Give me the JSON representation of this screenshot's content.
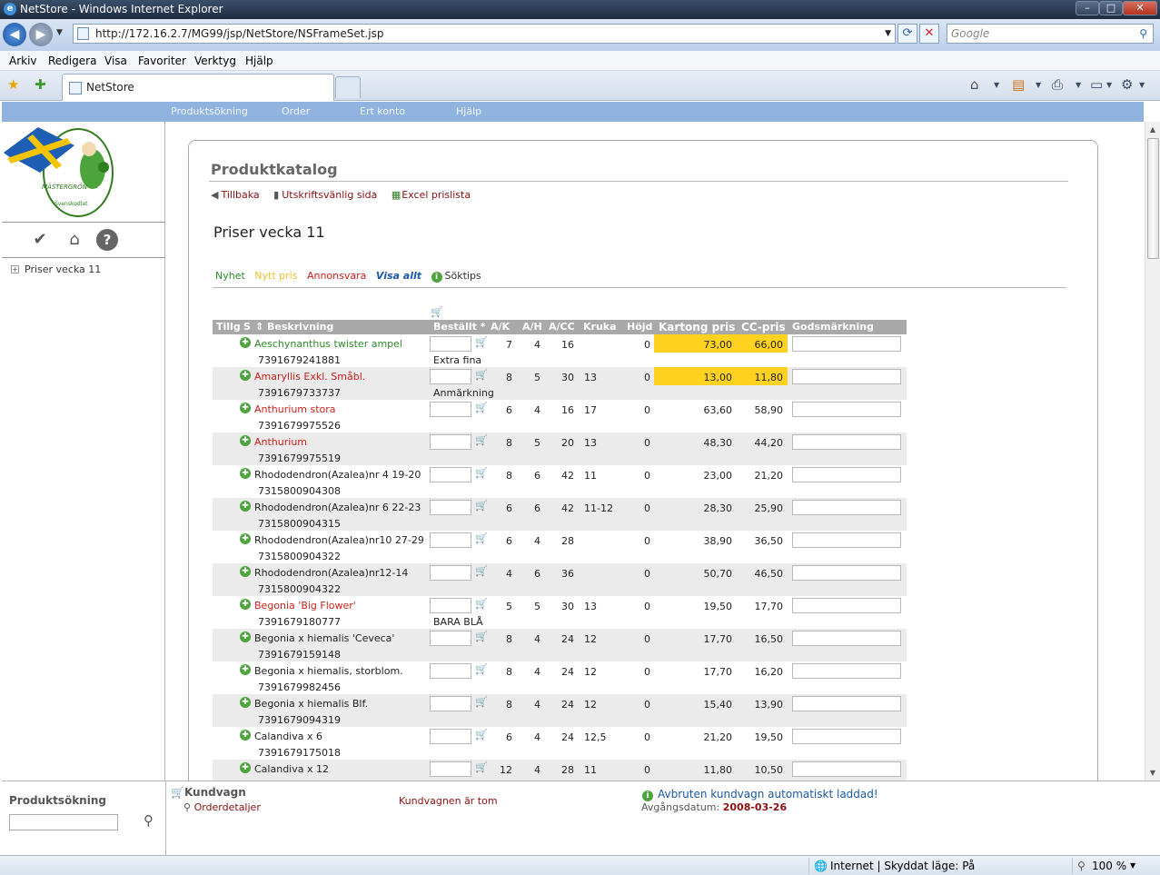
{
  "window": {
    "title": "NetStore - Windows Internet Explorer",
    "url": "http://172.16.2.7/MG99/jsp/NetStore/NSFrameSet.jsp",
    "search_placeholder": "Google",
    "tab_title": "NetStore"
  },
  "menu": [
    "Arkiv",
    "Redigera",
    "Visa",
    "Favoriter",
    "Verktyg",
    "Hjälp"
  ],
  "appnav": [
    "Produktsökning",
    "Order",
    "Ert konto",
    "Hjälp"
  ],
  "sidebar": {
    "tree_item": "Priser vecka 11",
    "logo_text": "MÄSTERGRÖN",
    "logo_sub": "Svenskodlat"
  },
  "page": {
    "title": "Produktkatalog",
    "back": "Tillbaka",
    "print": "Utskriftsvänlig sida",
    "excel": "Excel prislista",
    "heading": "Priser vecka 11"
  },
  "legend": [
    {
      "label": "Nyhet",
      "color": "#2f8a2a"
    },
    {
      "label": "Nytt pris",
      "color": "#f0c030"
    },
    {
      "label": "Annonsvara",
      "color": "#d0201a"
    },
    {
      "label": "Visa allt",
      "color": "#1a58a6"
    },
    {
      "label": "Söktips",
      "color": "#333333"
    }
  ],
  "table": {
    "headers": {
      "tillg": "Tillg",
      "s": "S",
      "beskrivning": "Beskrivning",
      "bestallt": "Beställt *",
      "ak": "A/K",
      "ah": "A/H",
      "acc": "A/CC",
      "kruka": "Kruka",
      "hojd": "Höjd",
      "kartong": "Kartong pris",
      "cc": "CC-pris",
      "gods": "Godsmärkning"
    },
    "rows": [
      {
        "name": "Aeschynanthus twister ampel",
        "ean": "7391679241881",
        "note": "Extra fina",
        "ak": "7",
        "ah": "4",
        "acc": "16",
        "kruka": "",
        "hojd": "0",
        "kartong": "73,00",
        "cc": "66,00",
        "color": "#2f8a2a",
        "highlight": true
      },
      {
        "name": "Amaryllis Exkl. Småbl.",
        "ean": "7391679733737",
        "note": "Anmärkning",
        "ak": "8",
        "ah": "5",
        "acc": "30",
        "kruka": "13",
        "hojd": "0",
        "kartong": "13,00",
        "cc": "11,80",
        "color": "#d0201a",
        "highlight": true
      },
      {
        "name": "Anthurium stora",
        "ean": "7391679975526",
        "note": "",
        "ak": "6",
        "ah": "4",
        "acc": "16",
        "kruka": "17",
        "hojd": "0",
        "kartong": "63,60",
        "cc": "58,90",
        "color": "#d0201a",
        "highlight": false
      },
      {
        "name": "Anthurium",
        "ean": "7391679975519",
        "note": "",
        "ak": "8",
        "ah": "5",
        "acc": "20",
        "kruka": "13",
        "hojd": "0",
        "kartong": "48,30",
        "cc": "44,20",
        "color": "#d0201a",
        "highlight": false
      },
      {
        "name": "Rhododendron(Azalea)nr 4 19-20",
        "ean": "7315800904308",
        "note": "",
        "ak": "8",
        "ah": "6",
        "acc": "42",
        "kruka": "11",
        "hojd": "0",
        "kartong": "23,00",
        "cc": "21,20",
        "color": "#222222",
        "highlight": false
      },
      {
        "name": "Rhododendron(Azalea)nr 6 22-23",
        "ean": "7315800904315",
        "note": "",
        "ak": "6",
        "ah": "6",
        "acc": "42",
        "kruka": "11-12",
        "hojd": "0",
        "kartong": "28,30",
        "cc": "25,90",
        "color": "#222222",
        "highlight": false
      },
      {
        "name": "Rhododendron(Azalea)nr10 27-29",
        "ean": "7315800904322",
        "note": "",
        "ak": "6",
        "ah": "4",
        "acc": "28",
        "kruka": "",
        "hojd": "0",
        "kartong": "38,90",
        "cc": "36,50",
        "color": "#222222",
        "highlight": false
      },
      {
        "name": "Rhododendron(Azalea)nr12-14",
        "ean": "7315800904322",
        "note": "",
        "ak": "4",
        "ah": "6",
        "acc": "36",
        "kruka": "",
        "hojd": "0",
        "kartong": "50,70",
        "cc": "46,50",
        "color": "#222222",
        "highlight": false
      },
      {
        "name": "Begonia 'Big Flower'",
        "ean": "7391679180777",
        "note": "BARA BLÅ",
        "ak": "5",
        "ah": "5",
        "acc": "30",
        "kruka": "13",
        "hojd": "0",
        "kartong": "19,50",
        "cc": "17,70",
        "color": "#d0201a",
        "highlight": false
      },
      {
        "name": "Begonia x hiemalis 'Ceveca'",
        "ean": "7391679159148",
        "note": "",
        "ak": "8",
        "ah": "4",
        "acc": "24",
        "kruka": "12",
        "hojd": "0",
        "kartong": "17,70",
        "cc": "16,50",
        "color": "#222222",
        "highlight": false
      },
      {
        "name": "Begonia x hiemalis, storblom.",
        "ean": "7391679982456",
        "note": "",
        "ak": "8",
        "ah": "4",
        "acc": "24",
        "kruka": "12",
        "hojd": "0",
        "kartong": "17,70",
        "cc": "16,20",
        "color": "#222222",
        "highlight": false
      },
      {
        "name": "Begonia x hiemalis Blf.",
        "ean": "7391679094319",
        "note": "",
        "ak": "8",
        "ah": "4",
        "acc": "24",
        "kruka": "12",
        "hojd": "0",
        "kartong": "15,40",
        "cc": "13,90",
        "color": "#222222",
        "highlight": false
      },
      {
        "name": "Calandiva x 6",
        "ean": "7391679175018",
        "note": "",
        "ak": "6",
        "ah": "4",
        "acc": "24",
        "kruka": "12,5",
        "hojd": "0",
        "kartong": "21,20",
        "cc": "19,50",
        "color": "#222222",
        "highlight": false
      },
      {
        "name": "Calandiva x 12",
        "ean": "",
        "note": "",
        "ak": "12",
        "ah": "4",
        "acc": "28",
        "kruka": "11",
        "hojd": "0",
        "kartong": "11,80",
        "cc": "10,50",
        "color": "#222222",
        "highlight": false
      }
    ]
  },
  "bottom": {
    "search_label": "Produktsökning",
    "cart_title": "Kundvagn",
    "order_details": "Orderdetaljer",
    "cart_empty": "Kundvagnen är tom",
    "auto_loaded": "Avbruten kundvagn automatiskt laddad!",
    "departure_label": "Avgångsdatum:",
    "departure_date": "2008-03-26"
  },
  "status": {
    "zone": "Internet | Skyddat läge: På",
    "zoom": "100 %"
  }
}
